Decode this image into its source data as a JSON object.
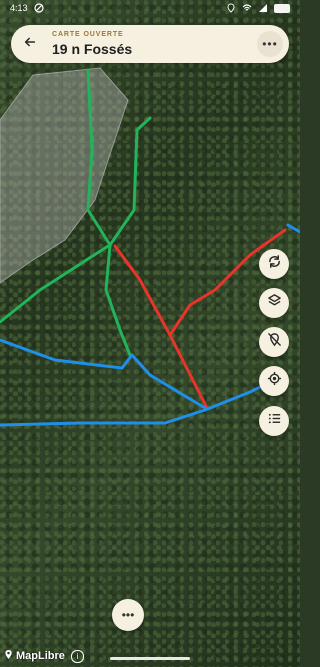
{
  "status_bar": {
    "time": "4:13"
  },
  "header": {
    "back_icon": "arrow-left-icon",
    "subtitle": "CARTE OUVERTE",
    "title": "19  n Fossés",
    "more_icon": "more-horizontal-icon",
    "more_label": "•••"
  },
  "map": {
    "colors": {
      "green": "#22b45a",
      "red": "#e8342a",
      "blue": "#1f8fe8",
      "zone": "#9a9a9a"
    }
  },
  "controls": [
    {
      "name": "sync-button",
      "icon": "sync-icon"
    },
    {
      "name": "layers-button",
      "icon": "layers-icon"
    },
    {
      "name": "location-off-button",
      "icon": "location-off-icon"
    },
    {
      "name": "my-location-button",
      "icon": "crosshair-icon"
    },
    {
      "name": "list-button",
      "icon": "list-icon"
    }
  ],
  "bottom": {
    "more_label": "•••"
  },
  "attribution": {
    "text": "MapLibre",
    "info": "i"
  }
}
